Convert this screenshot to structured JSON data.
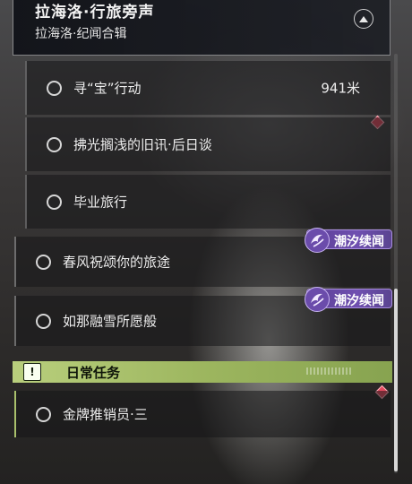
{
  "header": {
    "title": "拉海洛·行旅旁声",
    "subtitle": "拉海洛·纪闻合辑",
    "collapse_icon": "chevron-up-icon"
  },
  "sub_quests": [
    {
      "label": "寻“宝”行动",
      "distance": "941米"
    },
    {
      "label": "拂光搁浅的旧讯·后日谈"
    },
    {
      "label": "毕业旅行"
    }
  ],
  "main_quests": [
    {
      "label": "春风祝颂你的旅途",
      "tag": "潮汐续闻"
    },
    {
      "label": "如那融雪所愿般",
      "tag": "潮汐续闻"
    }
  ],
  "daily_section": {
    "title": "日常任务",
    "icon": "exclamation-icon",
    "items": [
      {
        "label": "金牌推销员·三"
      }
    ]
  },
  "colors": {
    "daily_accent": "#a9c06c",
    "tag_purple": "#6f4fb0",
    "marker_red": "#e24a5e"
  }
}
